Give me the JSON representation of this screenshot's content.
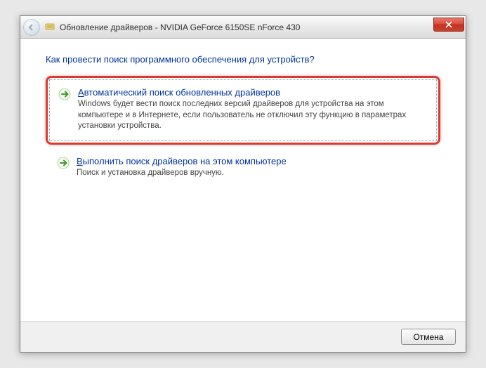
{
  "window": {
    "title": "Обновление драйверов - NVIDIA GeForce 6150SE nForce 430"
  },
  "heading": "Как провести поиск программного обеспечения для устройств?",
  "options": {
    "auto": {
      "hotkey": "А",
      "title_rest": "втоматический поиск обновленных драйверов",
      "desc": "Windows будет вести поиск последних версий драйверов для устройства на этом компьютере и в Интернете, если пользователь не отключил эту функцию в параметрах установки устройства."
    },
    "manual": {
      "hotkey": "В",
      "title_rest": "ыполнить поиск драйверов на этом компьютере",
      "desc": "Поиск и установка драйверов вручную."
    }
  },
  "footer": {
    "cancel": "Отмена"
  }
}
